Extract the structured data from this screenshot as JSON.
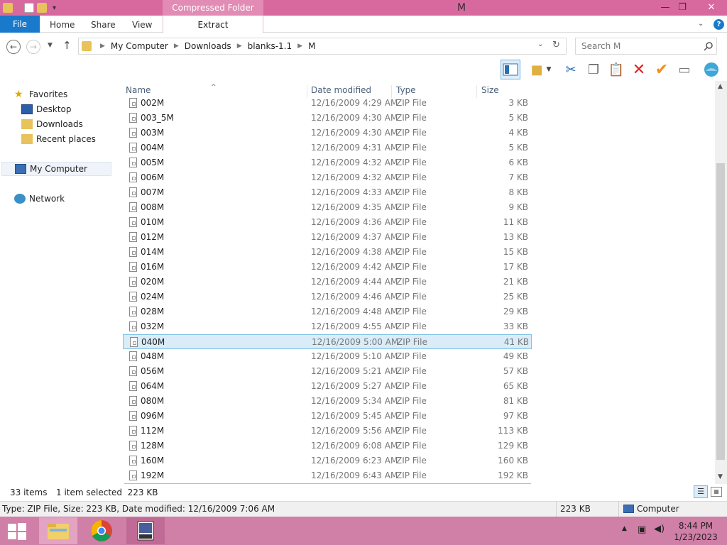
{
  "window": {
    "title": "M",
    "context_tab": "Compressed Folder Tools",
    "controls": {
      "minimize": "—",
      "maximize": "❐",
      "close": "✕"
    }
  },
  "ribbon": {
    "file": "File",
    "tabs": [
      "Home",
      "Share",
      "View"
    ],
    "extract": "Extract",
    "help": "?"
  },
  "address": {
    "breadcrumbs": [
      "My Computer",
      "Downloads",
      "blanks-1.1",
      "M"
    ]
  },
  "search": {
    "placeholder": "Search M"
  },
  "sidebar": {
    "favorites": "Favorites",
    "favorite_items": [
      "Desktop",
      "Downloads",
      "Recent places"
    ],
    "computer": "My Computer",
    "network": "Network"
  },
  "columns": {
    "name": "Name",
    "date": "Date modified",
    "type": "Type",
    "size": "Size"
  },
  "files": [
    {
      "name": "002M",
      "date": "12/16/2009 4:29 AM",
      "type": "ZIP File",
      "size": "3 KB"
    },
    {
      "name": "003_5M",
      "date": "12/16/2009 4:30 AM",
      "type": "ZIP File",
      "size": "5 KB"
    },
    {
      "name": "003M",
      "date": "12/16/2009 4:30 AM",
      "type": "ZIP File",
      "size": "4 KB"
    },
    {
      "name": "004M",
      "date": "12/16/2009 4:31 AM",
      "type": "ZIP File",
      "size": "5 KB"
    },
    {
      "name": "005M",
      "date": "12/16/2009 4:32 AM",
      "type": "ZIP File",
      "size": "6 KB"
    },
    {
      "name": "006M",
      "date": "12/16/2009 4:32 AM",
      "type": "ZIP File",
      "size": "7 KB"
    },
    {
      "name": "007M",
      "date": "12/16/2009 4:33 AM",
      "type": "ZIP File",
      "size": "8 KB"
    },
    {
      "name": "008M",
      "date": "12/16/2009 4:35 AM",
      "type": "ZIP File",
      "size": "9 KB"
    },
    {
      "name": "010M",
      "date": "12/16/2009 4:36 AM",
      "type": "ZIP File",
      "size": "11 KB"
    },
    {
      "name": "012M",
      "date": "12/16/2009 4:37 AM",
      "type": "ZIP File",
      "size": "13 KB"
    },
    {
      "name": "014M",
      "date": "12/16/2009 4:38 AM",
      "type": "ZIP File",
      "size": "15 KB"
    },
    {
      "name": "016M",
      "date": "12/16/2009 4:42 AM",
      "type": "ZIP File",
      "size": "17 KB"
    },
    {
      "name": "020M",
      "date": "12/16/2009 4:44 AM",
      "type": "ZIP File",
      "size": "21 KB"
    },
    {
      "name": "024M",
      "date": "12/16/2009 4:46 AM",
      "type": "ZIP File",
      "size": "25 KB"
    },
    {
      "name": "028M",
      "date": "12/16/2009 4:48 AM",
      "type": "ZIP File",
      "size": "29 KB"
    },
    {
      "name": "032M",
      "date": "12/16/2009 4:55 AM",
      "type": "ZIP File",
      "size": "33 KB"
    },
    {
      "name": "040M",
      "date": "12/16/2009 5:00 AM",
      "type": "ZIP File",
      "size": "41 KB",
      "selected": true
    },
    {
      "name": "048M",
      "date": "12/16/2009 5:10 AM",
      "type": "ZIP File",
      "size": "49 KB"
    },
    {
      "name": "056M",
      "date": "12/16/2009 5:21 AM",
      "type": "ZIP File",
      "size": "57 KB"
    },
    {
      "name": "064M",
      "date": "12/16/2009 5:27 AM",
      "type": "ZIP File",
      "size": "65 KB"
    },
    {
      "name": "080M",
      "date": "12/16/2009 5:34 AM",
      "type": "ZIP File",
      "size": "81 KB"
    },
    {
      "name": "096M",
      "date": "12/16/2009 5:45 AM",
      "type": "ZIP File",
      "size": "97 KB"
    },
    {
      "name": "112M",
      "date": "12/16/2009 5:56 AM",
      "type": "ZIP File",
      "size": "113 KB"
    },
    {
      "name": "128M",
      "date": "12/16/2009 6:08 AM",
      "type": "ZIP File",
      "size": "129 KB"
    },
    {
      "name": "160M",
      "date": "12/16/2009 6:23 AM",
      "type": "ZIP File",
      "size": "160 KB"
    },
    {
      "name": "192M",
      "date": "12/16/2009 6:43 AM",
      "type": "ZIP File",
      "size": "192 KB"
    }
  ],
  "status": {
    "count": "33 items",
    "selection": "1 item selected  223 KB"
  },
  "details": {
    "info": "Type: ZIP File, Size: 223 KB, Date modified: 12/16/2009 7:06 AM",
    "size": "223 KB",
    "location": "Computer"
  },
  "taskbar": {
    "time": "8:44 PM",
    "date": "1/23/2023"
  },
  "colors": {
    "titlebar": "#d8699f",
    "taskbar": "#d07fa7",
    "accent": "#1979ca",
    "selection": "#d9ecf7"
  }
}
